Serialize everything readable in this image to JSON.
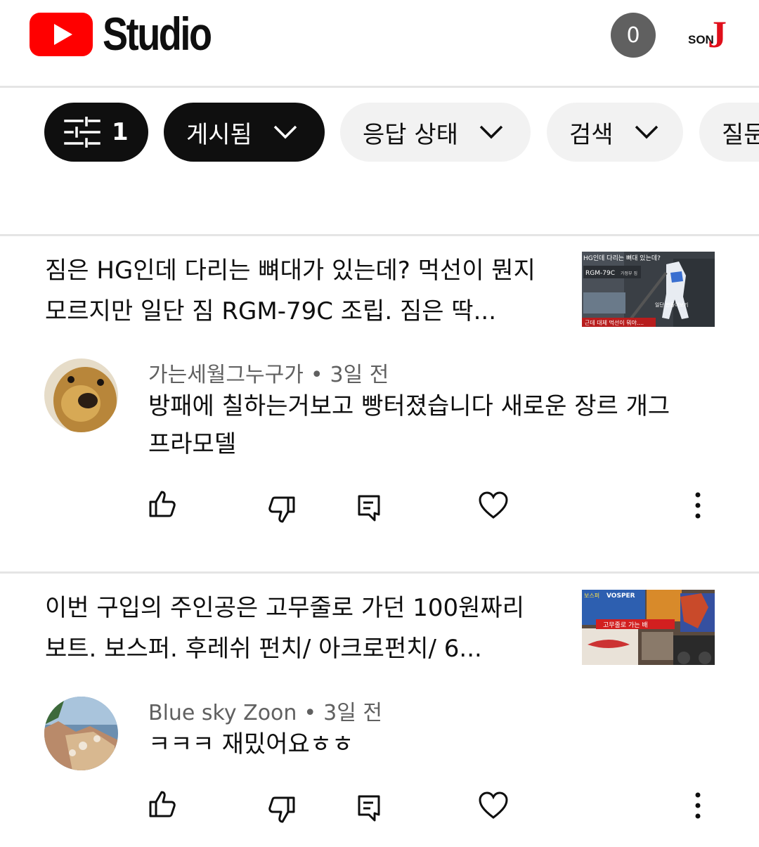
{
  "header": {
    "app_name": "Studio",
    "notification_count": "0",
    "account_badge_text": "SON",
    "account_badge_letter": "J"
  },
  "filters": {
    "filter_count": "1",
    "chips": [
      {
        "label": "게시됨"
      },
      {
        "label": "응답 상태"
      },
      {
        "label": "검색"
      },
      {
        "label": "질문"
      }
    ]
  },
  "comments": [
    {
      "video_title": "짐은 HG인데 다리는 뼈대가 있는데? 먹선이 뭔지 모르지만 일단 짐 RGM-79C 조립. 짐은 딱...",
      "thumbnail_text": {
        "title": "HG인데 다리는 뼈대 있는데?",
        "model": "RGM-79C",
        "model_sub": "가정부 짐",
        "side": "일단 만들어보기",
        "bottom": "근데 대체 먹선이 뭐야...."
      },
      "author": "가는세월그누구가",
      "time": "3일 전",
      "text": "방패에 칠하는거보고 빵터졌습니다 새로운 장르 개그 프라모델"
    },
    {
      "video_title": "이번 구입의 주인공은  고무줄로 가던 100원짜리 보트. 보스퍼. 후레쉬 펀치/ 아크로펀치/ 6...",
      "thumbnail_text": {
        "brand": "VOSPER",
        "box_label": "보스퍼",
        "banner": "고무줄로 가는 배"
      },
      "author": "Blue sky Zoon",
      "time": "3일 전",
      "text": "ㅋㅋㅋ 재밌어요ㅎㅎ"
    }
  ],
  "colors": {
    "brand_red": "#ff0000",
    "chip_dark": "#0f0f0f",
    "chip_light": "#f2f2f2",
    "secondary_text": "#606060"
  }
}
